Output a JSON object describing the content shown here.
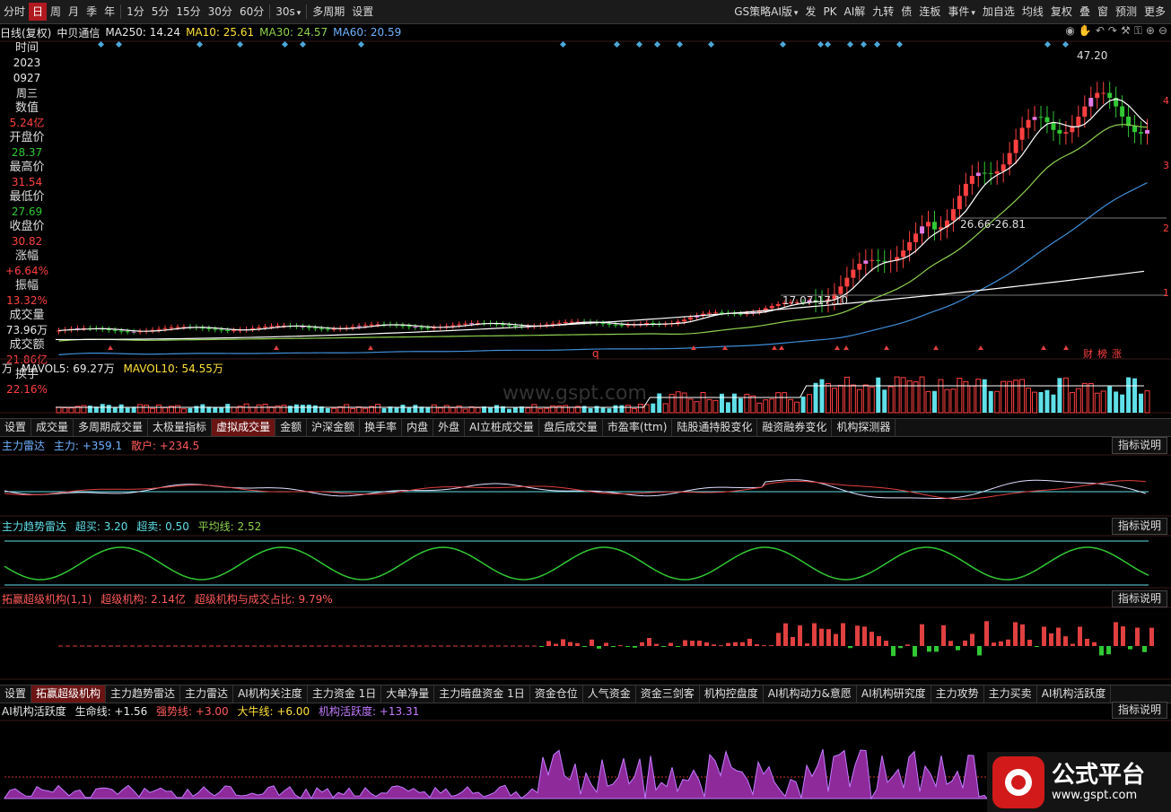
{
  "toolbar": {
    "left": [
      "分时",
      "日",
      "周",
      "月",
      "季",
      "年",
      "1分",
      "5分",
      "15分",
      "30分",
      "60分",
      "30s",
      "多周期",
      "设置"
    ],
    "active": "日",
    "right": [
      "GS策略AI版",
      "发",
      "PK",
      "AI解",
      "九转",
      "债",
      "连板",
      "事件",
      "加自选",
      "均线",
      "复权",
      "叠",
      "窗",
      "预测",
      "更多"
    ]
  },
  "info": {
    "period": "日线(复权)",
    "name": "中贝通信",
    "ma250": "MA250: 14.24",
    "ma10": "MA10: 25.61",
    "ma30": "MA30: 24.57",
    "ma60": "MA60: 20.59"
  },
  "side": [
    {
      "l": "时间",
      "v": "2023",
      "c": "wh"
    },
    {
      "l": "",
      "v": "0927",
      "c": "wh"
    },
    {
      "l": "",
      "v": "周三",
      "c": "wh"
    },
    {
      "l": "数值",
      "v": "5.24亿",
      "c": "up"
    },
    {
      "l": "开盘价",
      "v": "28.37",
      "c": "dn"
    },
    {
      "l": "最高价",
      "v": "31.54",
      "c": "up"
    },
    {
      "l": "最低价",
      "v": "27.69",
      "c": "dn"
    },
    {
      "l": "收盘价",
      "v": "30.82",
      "c": "up"
    },
    {
      "l": "涨幅",
      "v": "+6.64%",
      "c": "up"
    },
    {
      "l": "振幅",
      "v": "13.32%",
      "c": "up"
    },
    {
      "l": "成交量",
      "v": "73.96万",
      "c": "wh"
    },
    {
      "l": "成交额",
      "v": "21.86亿",
      "c": "up"
    },
    {
      "l": "换手",
      "v": "22.16%",
      "c": "up"
    }
  ],
  "annotations": {
    "high": "47.20",
    "mid": "26.66-26.81",
    "low": "17.07-17.10",
    "right_marks": [
      "财",
      "榜",
      "涨"
    ],
    "q": "q"
  },
  "volume": {
    "unit": "万",
    "mavol5": "MAVOL5: 69.27万",
    "mavol10": "MAVOL10: 54.55万"
  },
  "watermark": "www.gspt.com",
  "tabs1": [
    "设置",
    "成交量",
    "多周期成交量",
    "太极量指标",
    "虚拟成交量",
    "金额",
    "沪深金额",
    "换手率",
    "内盘",
    "外盘",
    "AI立桩成交量",
    "盘后成交量",
    "市盈率(ttm)",
    "陆股通持股变化",
    "融资融券变化",
    "机构探测器"
  ],
  "tabs1_active": "虚拟成交量",
  "ind1": {
    "name": "主力雷达",
    "a": "主力: +359.1",
    "b": "散户: +234.5"
  },
  "ind2": {
    "name": "主力趋势雷达",
    "a": "超买: 3.20",
    "b": "超卖: 0.50",
    "c": "平均线: 2.52"
  },
  "ind3": {
    "name": "拓赢超级机构(1,1)",
    "a": "超级机构: 2.14亿",
    "b": "超级机构与成交占比: 9.79%"
  },
  "tabs2": [
    "设置",
    "拓赢超级机构",
    "主力趋势雷达",
    "主力雷达",
    "AI机构关注度",
    "主力资金 1日",
    "大单净量",
    "主力暗盘资金 1日",
    "资金仓位",
    "人气资金",
    "资金三剑客",
    "机构控盘度",
    "AI机构动力&意愿",
    "AI机构研究度",
    "主力攻势",
    "主力买卖",
    "AI机构活跃度"
  ],
  "tabs2_active": "拓赢超级机构",
  "ind4": {
    "name": "AI机构活跃度",
    "a": "生命线: +1.56",
    "b": "强势线: +3.00",
    "c": "大牛线: +6.00",
    "d": "机构活跃度: +13.31"
  },
  "help": "指标说明",
  "logo": {
    "t1": "公式平台",
    "t2": "www.gspt.com"
  },
  "colors": {
    "up": "#ff4040",
    "down": "#31c834",
    "cyan": "#5fe0e8",
    "ma10": "#ffffff",
    "ma30": "#8fd14f",
    "ma60": "#3f8fd8",
    "ma250": "#ffffff"
  }
}
